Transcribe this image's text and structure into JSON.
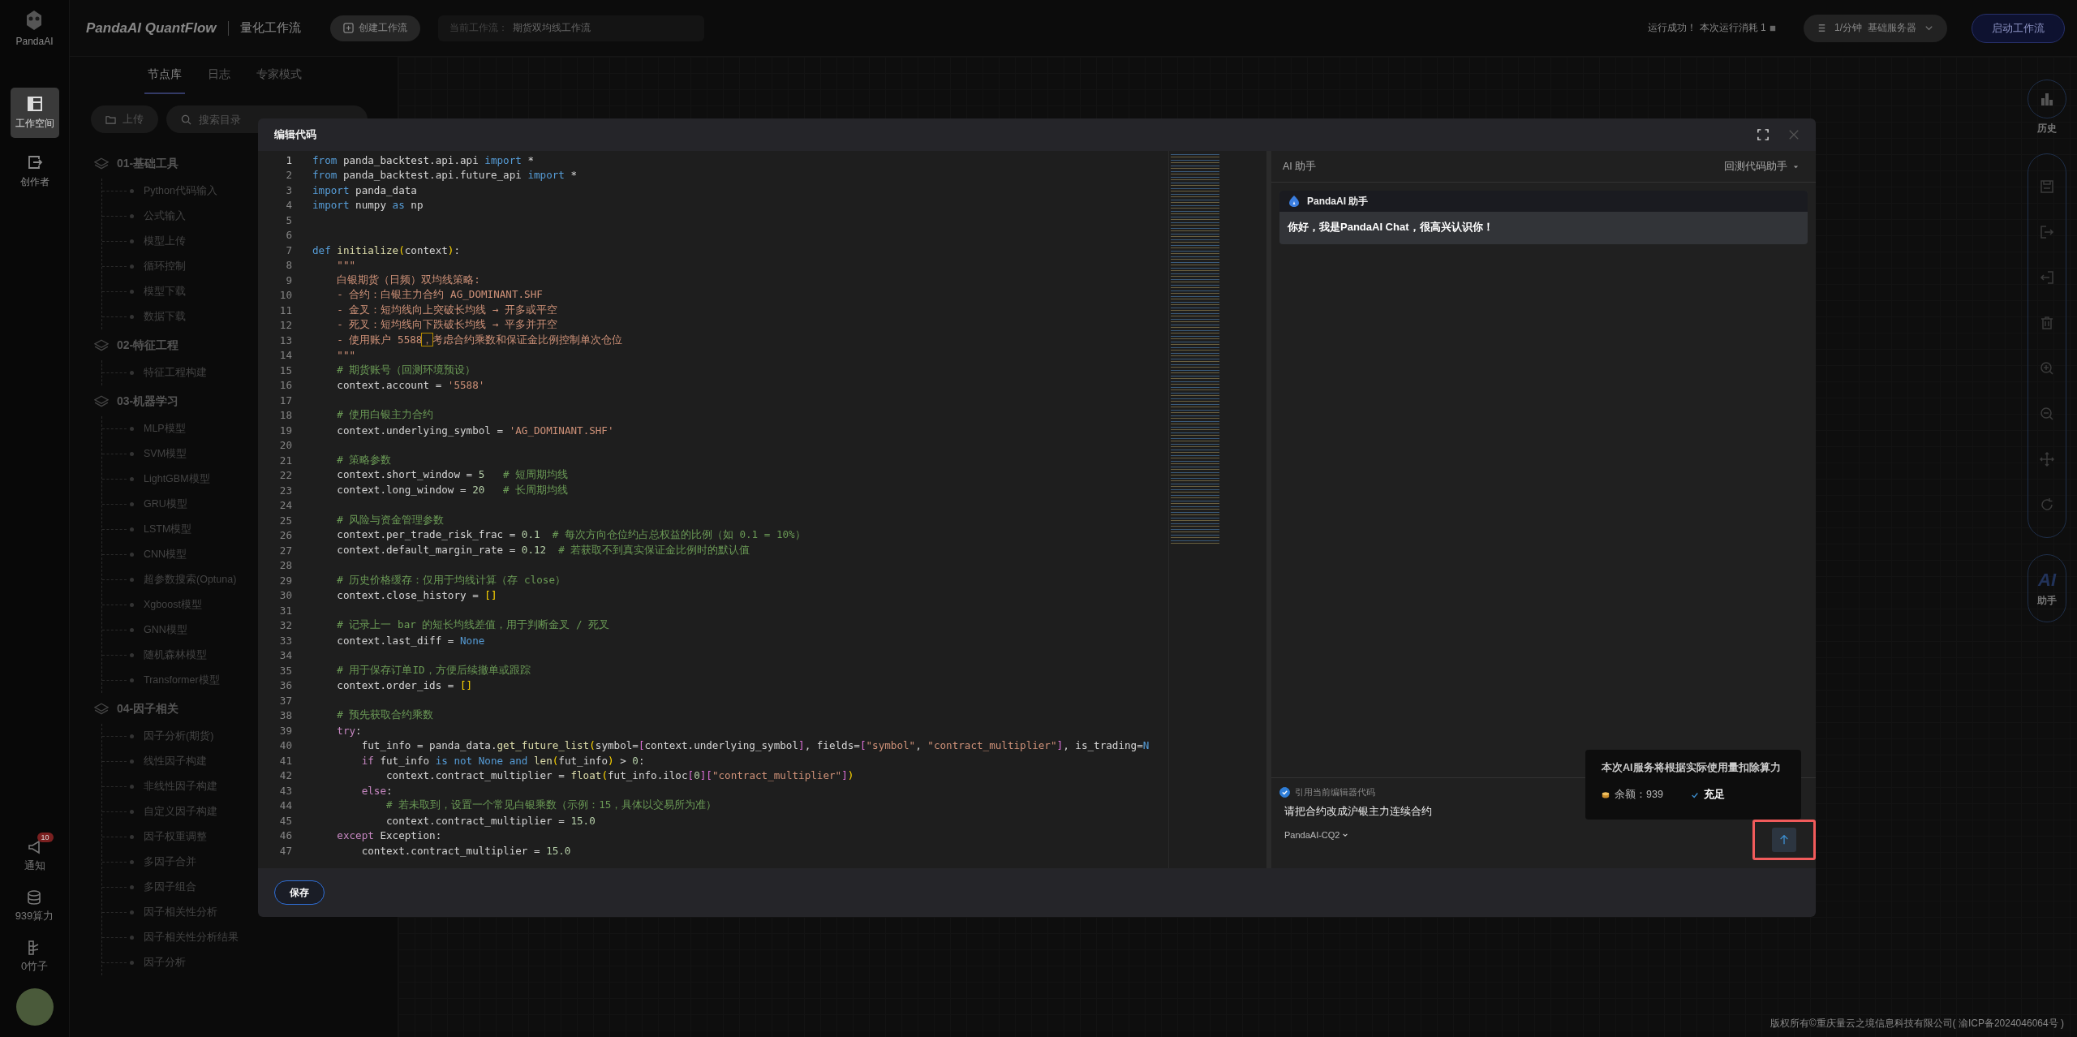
{
  "rail": {
    "logo_text": "PandaAI",
    "nav": [
      {
        "label": "工作空间",
        "selected": true
      },
      {
        "label": "创作者",
        "selected": false
      }
    ],
    "notifications": {
      "label": "通知",
      "badge": "10"
    },
    "compute": {
      "label": "939算力"
    },
    "bamboo": {
      "label": "0竹子"
    }
  },
  "topbar": {
    "brand": "PandaAI QuantFlow",
    "subtitle": "量化工作流",
    "create_button": "创建工作流",
    "current_label": "当前工作流：",
    "current_value": "期货双均线工作流",
    "status": "运行成功！ 本次运行消耗 1",
    "server": "1/分钟  基础服务器",
    "start_button": "启动工作流"
  },
  "node_panel": {
    "tabs": [
      {
        "label": "节点库",
        "selected": true
      },
      {
        "label": "日志",
        "selected": false
      },
      {
        "label": "专家模式",
        "selected": false
      }
    ],
    "upload_button": "上传",
    "search": {
      "placeholder": "搜索目录"
    },
    "groups": [
      {
        "label": "01-基础工具",
        "children": [
          {
            "label": "Python代码输入"
          },
          {
            "label": "公式输入"
          },
          {
            "label": "模型上传"
          },
          {
            "label": "循环控制"
          },
          {
            "label": "模型下载"
          },
          {
            "label": "数据下载"
          }
        ]
      },
      {
        "label": "02-特征工程",
        "children": [
          {
            "label": "特征工程构建"
          }
        ]
      },
      {
        "label": "03-机器学习",
        "children": [
          {
            "label": "MLP模型"
          },
          {
            "label": "SVM模型"
          },
          {
            "label": "LightGBM模型"
          },
          {
            "label": "GRU模型"
          },
          {
            "label": "LSTM模型"
          },
          {
            "label": "CNN模型"
          },
          {
            "label": "超参数搜索(Optuna)"
          },
          {
            "label": "Xgboost模型"
          },
          {
            "label": "GNN模型"
          },
          {
            "label": "随机森林模型"
          },
          {
            "label": "Transformer模型"
          }
        ]
      },
      {
        "label": "04-因子相关",
        "children": [
          {
            "label": "因子分析(期货)"
          },
          {
            "label": "线性因子构建"
          },
          {
            "label": "非线性因子构建"
          },
          {
            "label": "自定义因子构建"
          },
          {
            "label": "因子权重调整"
          },
          {
            "label": "多因子合并"
          },
          {
            "label": "多因子组合"
          },
          {
            "label": "因子相关性分析"
          },
          {
            "label": "因子相关性分析结果"
          },
          {
            "label": "因子分析"
          }
        ]
      }
    ]
  },
  "toolbar": {
    "history_label": "历史",
    "ai_mark": "AI",
    "ai_label": "助手"
  },
  "modal": {
    "title": "编辑代码",
    "save_button": "保存",
    "code": [
      {
        "no": "1",
        "tokens": [
          {
            "text": "from",
            "kind": "keyword"
          },
          {
            "text": " panda_backtest.api.api ",
            "kind": "plain"
          },
          {
            "text": "import",
            "kind": "keyword"
          },
          {
            "text": " *",
            "kind": "plain"
          }
        ]
      },
      {
        "no": "2",
        "tokens": [
          {
            "text": "from",
            "kind": "keyword"
          },
          {
            "text": " panda_backtest.api.future_api ",
            "kind": "plain"
          },
          {
            "text": "import",
            "kind": "keyword"
          },
          {
            "text": " *",
            "kind": "plain"
          }
        ]
      },
      {
        "no": "3",
        "tokens": [
          {
            "text": "import",
            "kind": "keyword"
          },
          {
            "text": " panda_data",
            "kind": "plain"
          }
        ]
      },
      {
        "no": "4",
        "tokens": [
          {
            "text": "import",
            "kind": "keyword"
          },
          {
            "text": " numpy ",
            "kind": "plain"
          },
          {
            "text": "as",
            "kind": "keyword"
          },
          {
            "text": " np",
            "kind": "plain"
          }
        ]
      },
      {
        "no": "5"
      },
      {
        "no": "6"
      },
      {
        "no": "7",
        "tokens": [
          {
            "text": "def ",
            "kind": "keyword"
          },
          {
            "text": "initialize",
            "kind": "function"
          },
          {
            "text": "(",
            "kind": "bracket"
          },
          {
            "text": "context",
            "kind": "plain"
          },
          {
            "text": ")",
            "kind": "bracket"
          },
          {
            "text": ":",
            "kind": "plain"
          }
        ]
      },
      {
        "no": "8",
        "tokens": [
          {
            "text": "    \"\"\"",
            "kind": "string"
          }
        ]
      },
      {
        "no": "9",
        "tokens": [
          {
            "text": "    白银期货（日频）双均线策略:",
            "kind": "string"
          }
        ]
      },
      {
        "no": "10",
        "tokens": [
          {
            "text": "    - 合约：白银主力合约 AG_DOMINANT.SHF",
            "kind": "string"
          }
        ]
      },
      {
        "no": "11",
        "tokens": [
          {
            "text": "    - 金叉：短均线向上突破长均线 → 开多或平空",
            "kind": "string"
          }
        ]
      },
      {
        "no": "12",
        "tokens": [
          {
            "text": "    - 死叉：短均线向下跌破长均线 → 平多并开空",
            "kind": "string"
          }
        ]
      },
      {
        "no": "13",
        "tokens": [
          {
            "text": "    - 使用账户 5588",
            "kind": "string"
          },
          {
            "text": "，",
            "kind": "match"
          },
          {
            "text": "考虑合约乘数和保证金比例控制单次仓位",
            "kind": "string"
          }
        ]
      },
      {
        "no": "14",
        "tokens": [
          {
            "text": "    \"\"\"",
            "kind": "string"
          }
        ]
      },
      {
        "no": "15",
        "tokens": [
          {
            "text": "    # 期货账号（回测环境预设）",
            "kind": "comment"
          }
        ]
      },
      {
        "no": "16",
        "tokens": [
          {
            "text": "    context.account = ",
            "kind": "plain"
          },
          {
            "text": "'5588'",
            "kind": "string"
          }
        ]
      },
      {
        "no": "17"
      },
      {
        "no": "18",
        "tokens": [
          {
            "text": "    # 使用白银主力合约",
            "kind": "comment"
          }
        ]
      },
      {
        "no": "19",
        "tokens": [
          {
            "text": "    context.underlying_symbol = ",
            "kind": "plain"
          },
          {
            "text": "'AG_DOMINANT.SHF'",
            "kind": "string"
          }
        ]
      },
      {
        "no": "20"
      },
      {
        "no": "21",
        "tokens": [
          {
            "text": "    # 策略参数",
            "kind": "comment"
          }
        ]
      },
      {
        "no": "22",
        "tokens": [
          {
            "text": "    context.short_window = ",
            "kind": "plain"
          },
          {
            "text": "5",
            "kind": "number"
          },
          {
            "text": "   # 短周期均线",
            "kind": "comment"
          }
        ]
      },
      {
        "no": "23",
        "tokens": [
          {
            "text": "    context.long_window = ",
            "kind": "plain"
          },
          {
            "text": "20",
            "kind": "number"
          },
          {
            "text": "   # 长周期均线",
            "kind": "comment"
          }
        ]
      },
      {
        "no": "24"
      },
      {
        "no": "25",
        "tokens": [
          {
            "text": "    # 风险与资金管理参数",
            "kind": "comment"
          }
        ]
      },
      {
        "no": "26",
        "tokens": [
          {
            "text": "    context.per_trade_risk_frac = ",
            "kind": "plain"
          },
          {
            "text": "0.1",
            "kind": "number"
          },
          {
            "text": "  # 每次方向仓位约占总权益的比例（如 0.1 = 10%）",
            "kind": "comment"
          }
        ]
      },
      {
        "no": "27",
        "tokens": [
          {
            "text": "    context.default_margin_rate = ",
            "kind": "plain"
          },
          {
            "text": "0.12",
            "kind": "number"
          },
          {
            "text": "  # 若获取不到真实保证金比例时的默认值",
            "kind": "comment"
          }
        ]
      },
      {
        "no": "28"
      },
      {
        "no": "29",
        "tokens": [
          {
            "text": "    # 历史价格缓存：仅用于均线计算（存 close）",
            "kind": "comment"
          }
        ]
      },
      {
        "no": "30",
        "tokens": [
          {
            "text": "    context.close_history = ",
            "kind": "plain"
          },
          {
            "text": "[]",
            "kind": "bracket"
          }
        ]
      },
      {
        "no": "31"
      },
      {
        "no": "32",
        "tokens": [
          {
            "text": "    # 记录上一 bar 的短长均线差值，用于判断金叉 / 死叉",
            "kind": "comment"
          }
        ]
      },
      {
        "no": "33",
        "tokens": [
          {
            "text": "    context.last_diff = ",
            "kind": "plain"
          },
          {
            "text": "None",
            "kind": "keyword"
          }
        ]
      },
      {
        "no": "34"
      },
      {
        "no": "35",
        "tokens": [
          {
            "text": "    # 用于保存订单ID，方便后续撤单或跟踪",
            "kind": "comment"
          }
        ]
      },
      {
        "no": "36",
        "tokens": [
          {
            "text": "    context.order_ids = ",
            "kind": "plain"
          },
          {
            "text": "[]",
            "kind": "bracket"
          }
        ]
      },
      {
        "no": "37"
      },
      {
        "no": "38",
        "tokens": [
          {
            "text": "    # 预先获取合约乘数",
            "kind": "comment"
          }
        ]
      },
      {
        "no": "39",
        "tokens": [
          {
            "text": "    try",
            "kind": "control"
          },
          {
            "text": ":",
            "kind": "plain"
          }
        ]
      },
      {
        "no": "40",
        "tokens": [
          {
            "text": "        fut_info = panda_data.",
            "kind": "plain"
          },
          {
            "text": "get_future_list",
            "kind": "function"
          },
          {
            "text": "(",
            "kind": "bracket"
          },
          {
            "text": "symbol=",
            "kind": "plain"
          },
          {
            "text": "[",
            "kind": "bracket2"
          },
          {
            "text": "context.underlying_symbol",
            "kind": "plain"
          },
          {
            "text": "]",
            "kind": "bracket2"
          },
          {
            "text": ", fields=",
            "kind": "plain"
          },
          {
            "text": "[",
            "kind": "bracket2"
          },
          {
            "text": "\"symbol\"",
            "kind": "string"
          },
          {
            "text": ", ",
            "kind": "plain"
          },
          {
            "text": "\"contract_multiplier\"",
            "kind": "string"
          },
          {
            "text": "]",
            "kind": "bracket2"
          },
          {
            "text": ", is_trading=",
            "kind": "plain"
          },
          {
            "text": "N",
            "kind": "keyword"
          }
        ]
      },
      {
        "no": "41",
        "tokens": [
          {
            "text": "        if",
            "kind": "control"
          },
          {
            "text": " fut_info ",
            "kind": "plain"
          },
          {
            "text": "is not None and ",
            "kind": "keyword"
          },
          {
            "text": "len",
            "kind": "function"
          },
          {
            "text": "(",
            "kind": "bracket"
          },
          {
            "text": "fut_info",
            "kind": "plain"
          },
          {
            "text": ")",
            "kind": "bracket"
          },
          {
            "text": " > ",
            "kind": "plain"
          },
          {
            "text": "0",
            "kind": "number"
          },
          {
            "text": ":",
            "kind": "plain"
          }
        ]
      },
      {
        "no": "42",
        "tokens": [
          {
            "text": "            context.contract_multiplier = ",
            "kind": "plain"
          },
          {
            "text": "float",
            "kind": "function"
          },
          {
            "text": "(",
            "kind": "bracket"
          },
          {
            "text": "fut_info.iloc",
            "kind": "plain"
          },
          {
            "text": "[",
            "kind": "bracket2"
          },
          {
            "text": "0",
            "kind": "number"
          },
          {
            "text": "]",
            "kind": "bracket2"
          },
          {
            "text": "[",
            "kind": "bracket2"
          },
          {
            "text": "\"contract_multiplier\"",
            "kind": "string"
          },
          {
            "text": "]",
            "kind": "bracket2"
          },
          {
            "text": ")",
            "kind": "bracket"
          }
        ]
      },
      {
        "no": "43",
        "tokens": [
          {
            "text": "        else",
            "kind": "control"
          },
          {
            "text": ":",
            "kind": "plain"
          }
        ]
      },
      {
        "no": "44",
        "tokens": [
          {
            "text": "            # 若未取到，设置一个常见白银乘数（示例：15，具体以交易所为准）",
            "kind": "comment"
          }
        ]
      },
      {
        "no": "45",
        "tokens": [
          {
            "text": "            context.contract_multiplier = ",
            "kind": "plain"
          },
          {
            "text": "15.0",
            "kind": "number"
          }
        ]
      },
      {
        "no": "46",
        "tokens": [
          {
            "text": "    except",
            "kind": "control"
          },
          {
            "text": " Exception:",
            "kind": "plain"
          }
        ]
      },
      {
        "no": "47",
        "tokens": [
          {
            "text": "        context.contract_multiplier = ",
            "kind": "plain"
          },
          {
            "text": "15.0",
            "kind": "number"
          }
        ]
      }
    ],
    "assistant": {
      "title": "AI 助手",
      "mode": "回测代码助手",
      "sender": "PandaAI 助手",
      "message": "你好，我是PandaAI Chat，很高兴认识你！",
      "reference": {
        "label": "引用当前编辑器代码",
        "checked": true
      },
      "input": {
        "value": "请把合约改成沪银主力连续合约"
      },
      "model": "PandaAI-CQ2",
      "tooltip": {
        "text": "本次AI服务将根据实际使用量扣除算力",
        "balance": "余额：939",
        "status": "充足"
      }
    }
  },
  "footer": {
    "copyright": "版权所有©重庆量云之境信息科技有限公司( 渝ICP备2024046064号 )"
  }
}
